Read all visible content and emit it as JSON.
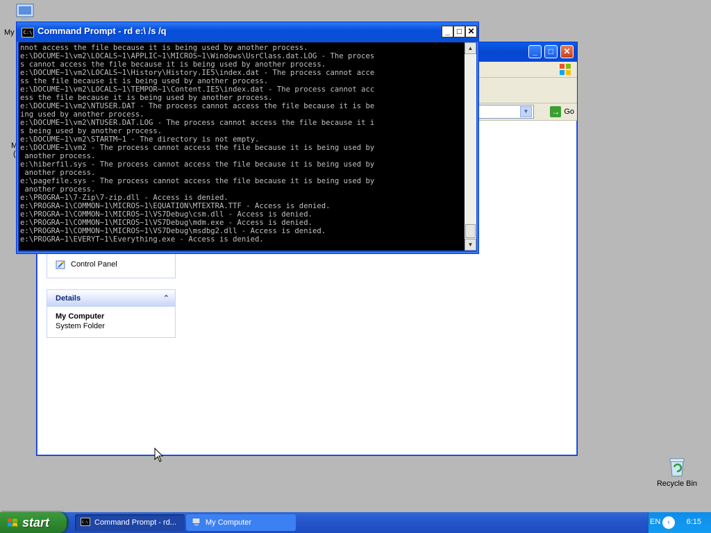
{
  "desktop": {
    "my_computer_label": "My",
    "partial_label_1": "M",
    "partial_label_2": "(",
    "recycle_bin_label": "Recycle Bin"
  },
  "explorer": {
    "go_label": "Go",
    "other_places": {
      "control_panel": "Control Panel"
    },
    "details": {
      "header": "Details",
      "item_title": "My Computer",
      "item_subtitle": "System Folder"
    },
    "min_label": "_",
    "max_label": "□",
    "close_label": "✕"
  },
  "cmd": {
    "title": "Command Prompt - rd e:\\ /s /q",
    "icon_text": "C:\\",
    "min_label": "_",
    "max_label": "□",
    "close_label": "✕",
    "output": "nnot access the file because it is being used by another process.\ne:\\DOCUME~1\\vm2\\LOCALS~1\\APPLIC~1\\MICROS~1\\Windows\\UsrClass.dat.LOG - The proces\ns cannot access the file because it is being used by another process.\ne:\\DOCUME~1\\vm2\\LOCALS~1\\History\\History.IE5\\index.dat - The process cannot acce\nss the file because it is being used by another process.\ne:\\DOCUME~1\\vm2\\LOCALS~1\\TEMPOR~1\\Content.IE5\\index.dat - The process cannot acc\ness the file because it is being used by another process.\ne:\\DOCUME~1\\vm2\\NTUSER.DAT - The process cannot access the file because it is be\ning used by another process.\ne:\\DOCUME~1\\vm2\\NTUSER.DAT.LOG - The process cannot access the file because it i\ns being used by another process.\ne:\\DOCUME~1\\vm2\\STARTM~1 - The directory is not empty.\ne:\\DOCUME~1\\vm2 - The process cannot access the file because it is being used by\n another process.\ne:\\hiberfil.sys - The process cannot access the file because it is being used by\n another process.\ne:\\pagefile.sys - The process cannot access the file because it is being used by\n another process.\ne:\\PROGRA~1\\7-Zip\\7-zip.dll - Access is denied.\ne:\\PROGRA~1\\COMMON~1\\MICROS~1\\EQUATION\\MTEXTRA.TTF - Access is denied.\ne:\\PROGRA~1\\COMMON~1\\MICROS~1\\VS7Debug\\csm.dll - Access is denied.\ne:\\PROGRA~1\\COMMON~1\\MICROS~1\\VS7Debug\\mdm.exe - Access is denied.\ne:\\PROGRA~1\\COMMON~1\\MICROS~1\\VS7Debug\\msdbg2.dll - Access is denied.\ne:\\PROGRA~1\\EVERYT~1\\Everything.exe - Access is denied.\n_"
  },
  "taskbar": {
    "start_label": "start",
    "tasks": [
      {
        "label": "Command Prompt - rd...",
        "active": true
      },
      {
        "label": "My Computer",
        "active": false
      }
    ],
    "language": "EN",
    "clock": "6:15"
  },
  "colors": {
    "xp_blue": "#0a4fd6",
    "start_green": "#2f8a2f",
    "console_bg": "#000000",
    "console_fg": "#c0c0c0"
  }
}
